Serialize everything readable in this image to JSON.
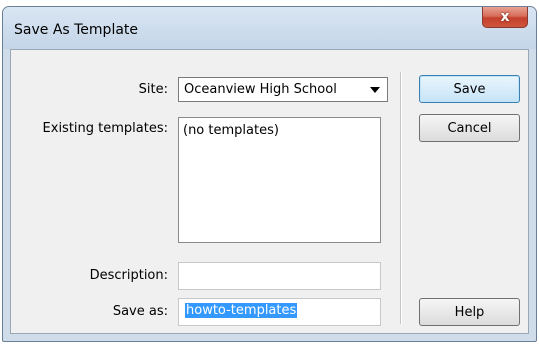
{
  "window": {
    "title": "Save As Template",
    "close_glyph": "x"
  },
  "form": {
    "site_label": "Site:",
    "site_value": "Oceanview High School",
    "existing_label": "Existing templates:",
    "existing_items": [
      "(no templates)"
    ],
    "description_label": "Description:",
    "description_value": "",
    "save_as_label": "Save as:",
    "save_as_value": "howto-templates"
  },
  "buttons": {
    "save": "Save",
    "cancel": "Cancel",
    "help": "Help"
  },
  "icons": {
    "close": "close-icon",
    "dropdown": "chevron-down-icon"
  },
  "colors": {
    "selection": "#3399ff",
    "close_button": "#c4402c",
    "default_button_border": "#3c7fb1"
  }
}
